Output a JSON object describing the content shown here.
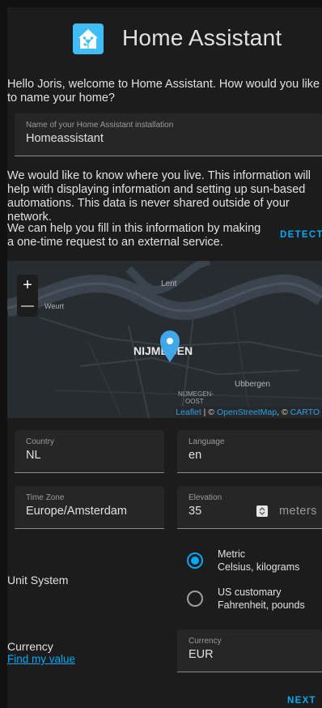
{
  "header": {
    "title": "Home Assistant",
    "logo_icon": "home-assistant-logo-icon"
  },
  "intro_text": "Hello Joris, welcome to Home Assistant. How would you like to name your home?",
  "name_field": {
    "label": "Name of your Home Assistant installation",
    "value": "Homeassistant"
  },
  "location_text": "We would like to know where you live. This information will help with displaying information and setting up sun-based automations. This data is never shared outside of your network.",
  "detect_text": "We can help you fill in this information by making a one-time request to an external service.",
  "detect_button": "DETECT",
  "map": {
    "zoom_in": "+",
    "zoom_out": "—",
    "places": {
      "lent": "Lent",
      "weurt": "Weurt",
      "nijmegen": "NIJMEGEN",
      "nijmegen_oost_line1": "NIJMEGEN-",
      "nijmegen_oost_line2": "OOST",
      "ubbergen": "Ubbergen"
    },
    "attribution": {
      "leaflet": "Leaflet",
      "separator": " | © ",
      "osm": "OpenStreetMap",
      "comma": ", © ",
      "carto": "CARTO"
    },
    "marker_icon": "map-marker-icon"
  },
  "country": {
    "label": "Country",
    "value": "NL"
  },
  "language": {
    "label": "Language",
    "value": "en"
  },
  "time_zone": {
    "label": "Time Zone",
    "value": "Europe/Amsterdam"
  },
  "elevation": {
    "label": "Elevation",
    "value": "35",
    "suffix": "meters"
  },
  "unit_system": {
    "label": "Unit System",
    "options": [
      {
        "title": "Metric",
        "subtitle": "Celsius, kilograms",
        "selected": true
      },
      {
        "title": "US customary",
        "subtitle": "Fahrenheit, pounds",
        "selected": false
      }
    ]
  },
  "currency": {
    "label": "Currency",
    "link": "Find my value",
    "field_label": "Currency",
    "value": "EUR"
  },
  "next_button": "NEXT",
  "colors": {
    "accent": "#03a9f4",
    "logo": "#41bdf5",
    "background": "#1c1c1c",
    "field": "#262626"
  }
}
